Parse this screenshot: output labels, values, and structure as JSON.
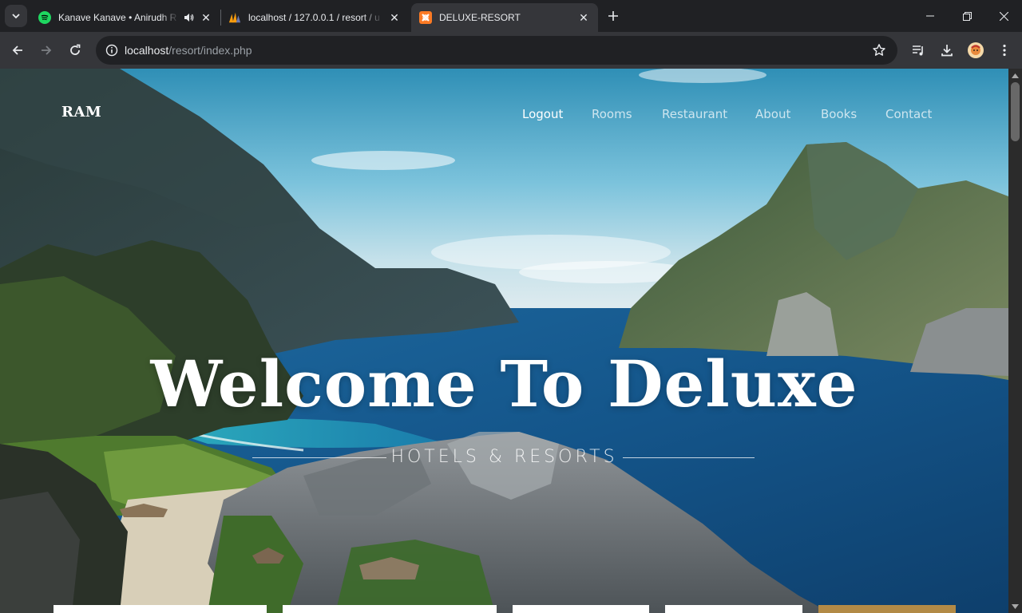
{
  "browser": {
    "tabs": [
      {
        "title": "Kanave Kanave • Anirudh R",
        "favicon": "spotify-icon",
        "audio": true,
        "active": false
      },
      {
        "title": "localhost / 127.0.0.1 / resort / u",
        "favicon": "phpmyadmin-icon",
        "active": false
      },
      {
        "title": "DELUXE-RESORT",
        "favicon": "xampp-icon",
        "active": true
      }
    ],
    "address": {
      "host": "localhost",
      "path": "/resort/index.php"
    }
  },
  "site": {
    "brand": "RAM",
    "nav": [
      {
        "label": "Logout",
        "active": true
      },
      {
        "label": "Rooms",
        "active": false
      },
      {
        "label": "Restaurant",
        "active": false
      },
      {
        "label": "About",
        "active": false
      },
      {
        "label": "Books",
        "active": false
      },
      {
        "label": "Contact",
        "active": false
      }
    ],
    "hero": {
      "title": "Welcome To Deluxe",
      "subtitle": "HOTELS & RESORTS"
    }
  },
  "colors": {
    "accent_gold": "#b28a46",
    "spotify_green": "#1ed760",
    "xampp_orange": "#fb7a24"
  }
}
